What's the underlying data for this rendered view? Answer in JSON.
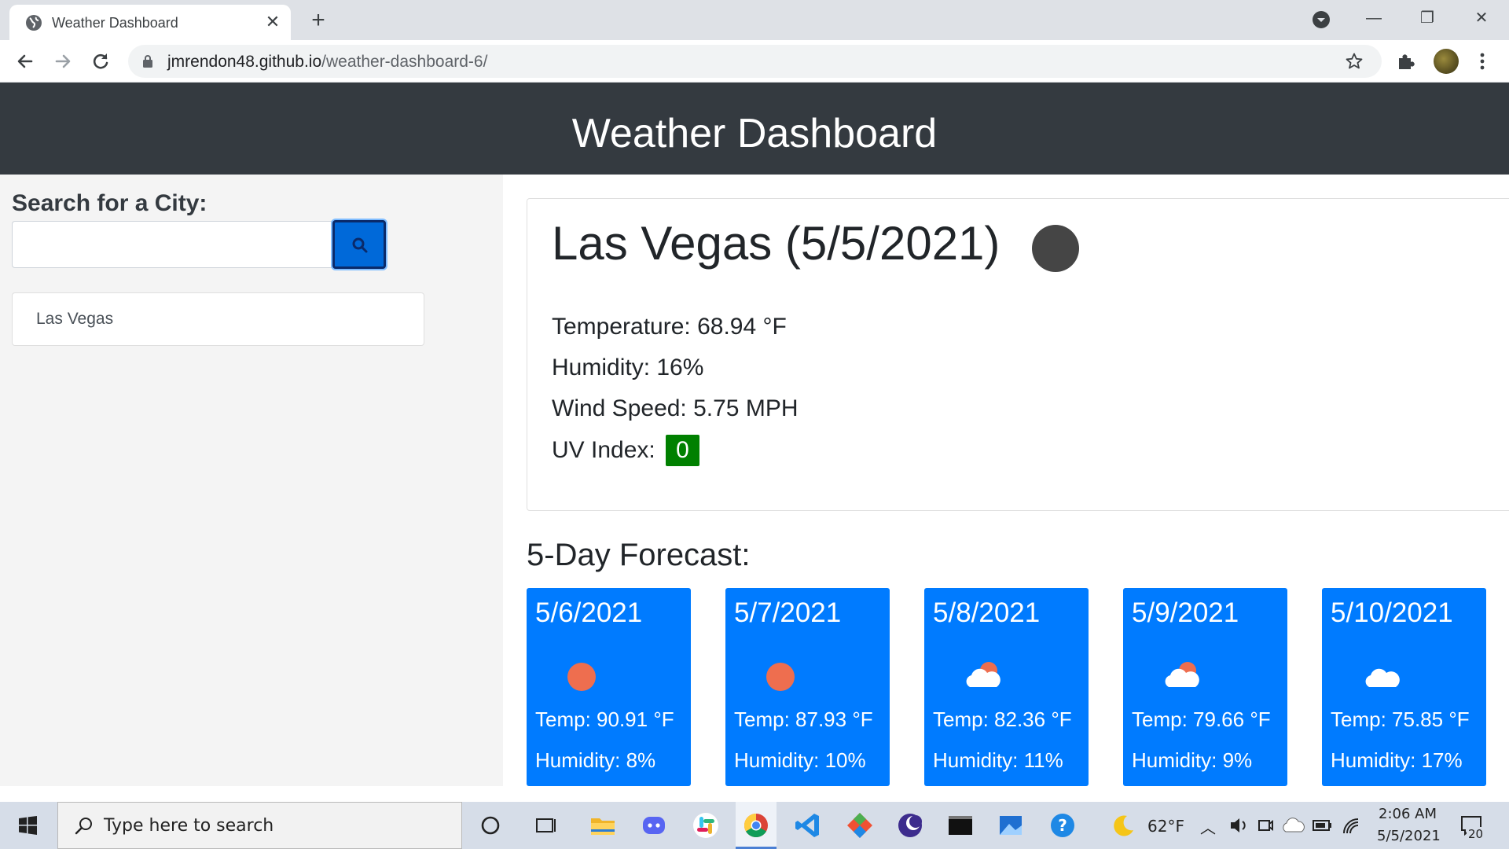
{
  "browser": {
    "tab_title": "Weather Dashboard",
    "url_host": "jmrendon48.github.io",
    "url_path": "/weather-dashboard-6/"
  },
  "page": {
    "header_title": "Weather Dashboard",
    "search_label": "Search for a City:",
    "search_value": "",
    "history": [
      "Las Vegas"
    ],
    "current": {
      "title": "Las Vegas (5/5/2021)",
      "temperature": "Temperature: 68.94 °F",
      "humidity": "Humidity: 16%",
      "wind": "Wind Speed: 5.75 MPH",
      "uv_label": "UV Index:",
      "uv_value": "0",
      "uv_color": "#008000",
      "icon": "night-clear-icon"
    },
    "forecast_title": "5-Day Forecast:",
    "forecast": [
      {
        "date": "5/6/2021",
        "icon": "sun-icon",
        "temp": "Temp: 90.91 °F",
        "humidity": "Humidity: 8%"
      },
      {
        "date": "5/7/2021",
        "icon": "sun-icon",
        "temp": "Temp: 87.93 °F",
        "humidity": "Humidity: 10%"
      },
      {
        "date": "5/8/2021",
        "icon": "partly-cloudy-icon",
        "temp": "Temp: 82.36 °F",
        "humidity": "Humidity: 11%"
      },
      {
        "date": "5/9/2021",
        "icon": "partly-cloudy-icon",
        "temp": "Temp: 79.66 °F",
        "humidity": "Humidity: 9%"
      },
      {
        "date": "5/10/2021",
        "icon": "cloud-icon",
        "temp": "Temp: 75.85 °F",
        "humidity": "Humidity: 17%"
      }
    ],
    "colors": {
      "header_bg": "#343a40",
      "card_bg": "#007bff",
      "button_bg": "#0069d9"
    }
  },
  "taskbar": {
    "search_placeholder": "Type here to search",
    "weather_temp": "62°F",
    "time": "2:06 AM",
    "date": "5/5/2021",
    "notification_count": "20"
  }
}
